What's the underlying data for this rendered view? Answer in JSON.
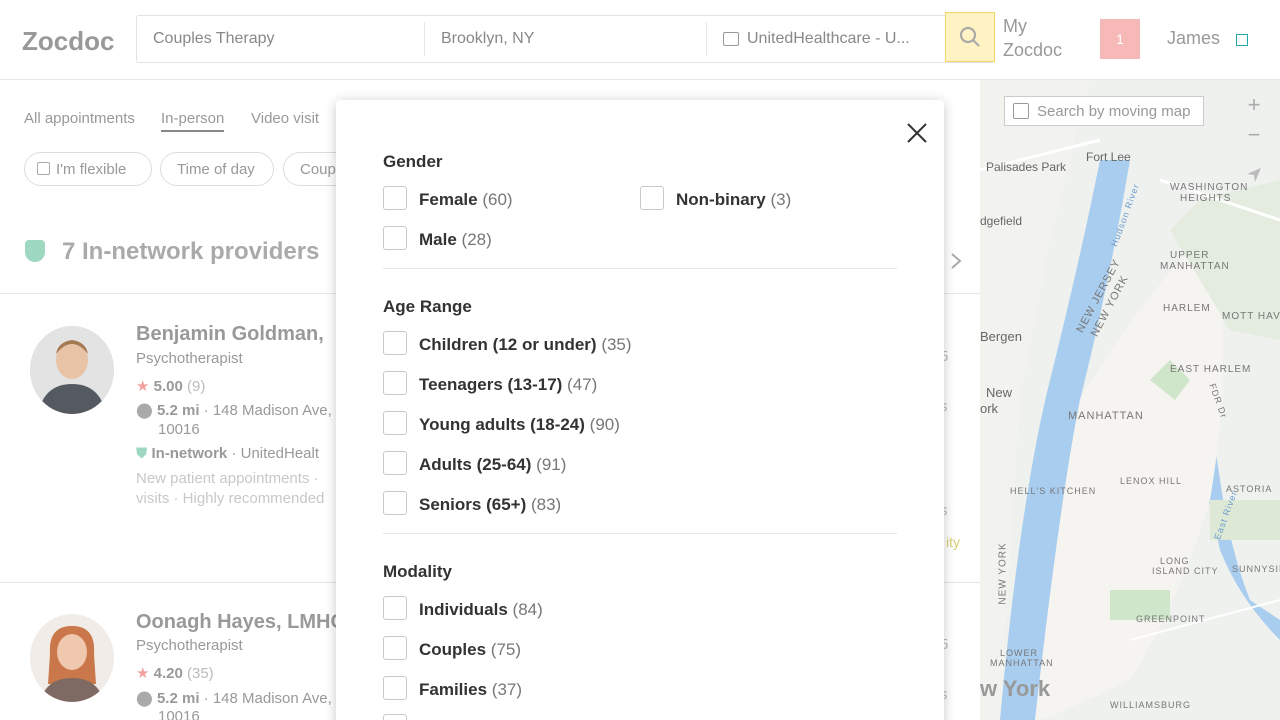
{
  "header": {
    "logo": "Zocdoc",
    "search_specialty": "Couples Therapy",
    "search_location": "Brooklyn, NY",
    "search_insurance": "UnitedHealthcare - U...",
    "my_zocdoc_1": "My",
    "my_zocdoc_2": "Zocdoc",
    "user_name": "James",
    "avatar_text": "1"
  },
  "filters": {
    "tabs": [
      "All appointments",
      "In-person",
      "Video visit"
    ],
    "pills": [
      "I'm flexible",
      "Time of day",
      "Coup"
    ]
  },
  "results": {
    "title": "7 In-network providers"
  },
  "doctors": [
    {
      "name": "Benjamin Goldman,",
      "specialty": "Psychotherapist",
      "rating": "5.00",
      "reviews": "(9)",
      "distance": "5.2 mi",
      "address": "148 Madison Ave,",
      "zip": "10016",
      "network": "In-network",
      "network_plan": "UnitedHealt",
      "note1": "New patient appointments ·",
      "note2": "visits · Highly recommended"
    },
    {
      "name": "Oonagh Hayes, LMHC",
      "specialty": "Psychotherapist",
      "rating": "4.20",
      "reviews": "(35)",
      "distance": "5.2 mi",
      "address": "148 Madison Ave,",
      "zip": "10016"
    }
  ],
  "map": {
    "search_label": "Search by moving map",
    "labels": {
      "palisades": "Palisades Park",
      "fortlee": "Fort Lee",
      "washington": "WASHINGTON",
      "heights": "HEIGHTS",
      "edgefield": "dgefield",
      "upper": "UPPER",
      "manhattan_upper": "MANHATTAN",
      "harlem": "HARLEM",
      "motthaven": "MOTT HAVEN",
      "bergen": "Bergen",
      "eastharlem": "EAST HARLEM",
      "new": "New",
      "york_partial": "ork",
      "manhattan": "MANHATTAN",
      "hellskitchen": "HELL'S KITCHEN",
      "lenoxhill": "LENOX HILL",
      "astoria": "ASTORIA",
      "longisland1": "LONG",
      "longisland2": "ISLAND CITY",
      "sunnyside": "SUNNYSIDE",
      "greenpoint": "GREENPOINT",
      "lower": "LOWER",
      "lowermanhattan": "MANHATTAN",
      "newyork": "w York",
      "williamsburg": "WILLIAMSBURG",
      "newjersey": "NEW JERSEY",
      "newyork_diag": "NEW YORK",
      "hudson": "Hudson River",
      "east_river": "East River",
      "newyork_vert": "NEW YORK",
      "fdr": "FDR Dr"
    }
  },
  "modal": {
    "gender": {
      "title": "Gender",
      "options": [
        {
          "label": "Female",
          "count": "(60)"
        },
        {
          "label": "Non-binary",
          "count": "(3)"
        },
        {
          "label": "Male",
          "count": "(28)"
        }
      ]
    },
    "age": {
      "title": "Age Range",
      "options": [
        {
          "label": "Children (12 or under)",
          "count": "(35)"
        },
        {
          "label": "Teenagers (13-17)",
          "count": "(47)"
        },
        {
          "label": "Young adults (18-24)",
          "count": "(90)"
        },
        {
          "label": "Adults (25-64)",
          "count": "(91)"
        },
        {
          "label": "Seniors (65+)",
          "count": "(83)"
        }
      ]
    },
    "modality": {
      "title": "Modality",
      "options": [
        {
          "label": "Individuals",
          "count": "(84)"
        },
        {
          "label": "Couples",
          "count": "(75)"
        },
        {
          "label": "Families",
          "count": "(37)"
        }
      ]
    }
  },
  "ghost": {
    "a": "5",
    "b": "s",
    "c": "y",
    "d": "n",
    "e": "s",
    "f": "ity",
    "g": "5",
    "h": "s"
  }
}
